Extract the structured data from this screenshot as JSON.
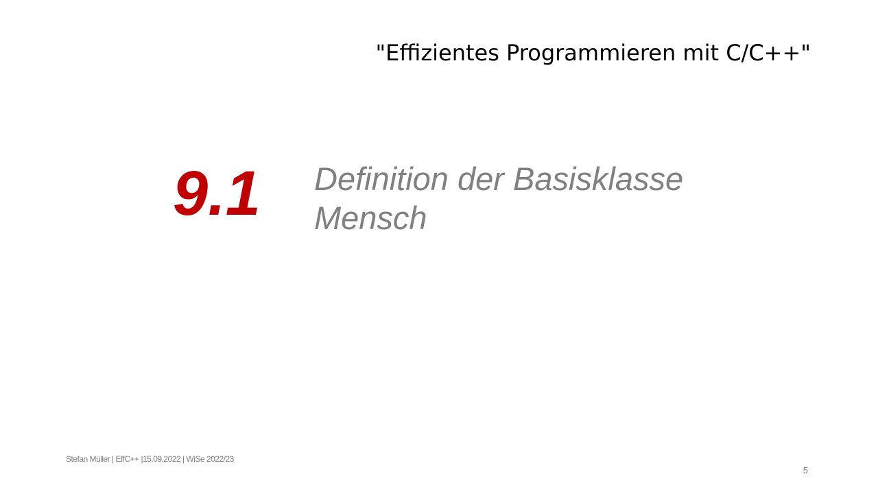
{
  "header": {
    "course_title": "\"Effizientes Programmieren mit C/C++\""
  },
  "section": {
    "number": "9.1",
    "title_line1": "Definition der Basisklasse",
    "title_line2": "Mensch"
  },
  "footer": {
    "text": "Stefan Müller | EffC++ |15.09.2022 | WiSe 2022/23",
    "page_number": "5"
  }
}
